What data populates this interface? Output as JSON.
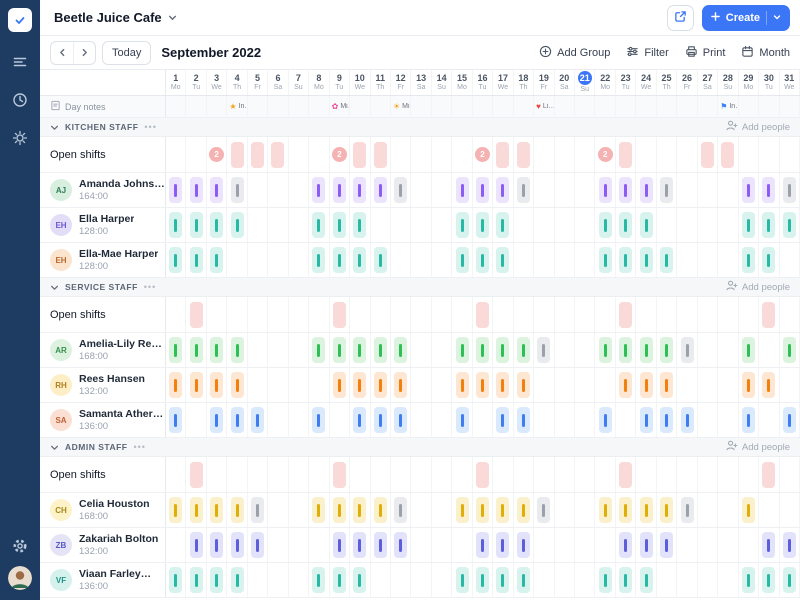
{
  "colors": {
    "accent": "#3b76f6",
    "sidebar": "#1e3c61",
    "open_shift_bg": "#fad9d9",
    "badge_bg": "#f5b2b2",
    "badge_fg": "#ffffff"
  },
  "header": {
    "workspace_name": "Beetle Juice Cafe",
    "create_label": "Create"
  },
  "toolbar": {
    "today": "Today",
    "title": "September 2022",
    "add_group": "Add Group",
    "filter": "Filter",
    "print": "Print",
    "view": "Month"
  },
  "calendar": {
    "today": 21,
    "notes_label": "Day notes",
    "days": [
      {
        "n": 1,
        "d": "Mo"
      },
      {
        "n": 2,
        "d": "Tu"
      },
      {
        "n": 3,
        "d": "We"
      },
      {
        "n": 4,
        "d": "Th"
      },
      {
        "n": 5,
        "d": "Fr"
      },
      {
        "n": 6,
        "d": "Sa"
      },
      {
        "n": 7,
        "d": "Su"
      },
      {
        "n": 8,
        "d": "Mo"
      },
      {
        "n": 9,
        "d": "Tu"
      },
      {
        "n": 10,
        "d": "We"
      },
      {
        "n": 11,
        "d": "Th"
      },
      {
        "n": 12,
        "d": "Fr"
      },
      {
        "n": 13,
        "d": "Sa"
      },
      {
        "n": 14,
        "d": "Su"
      },
      {
        "n": 15,
        "d": "Mo"
      },
      {
        "n": 16,
        "d": "Tu"
      },
      {
        "n": 17,
        "d": "We"
      },
      {
        "n": 18,
        "d": "Th"
      },
      {
        "n": 19,
        "d": "Fr"
      },
      {
        "n": 20,
        "d": "Sa"
      },
      {
        "n": 21,
        "d": "Su"
      },
      {
        "n": 22,
        "d": "Mo"
      },
      {
        "n": 23,
        "d": "Tu"
      },
      {
        "n": 24,
        "d": "We"
      },
      {
        "n": 25,
        "d": "Th"
      },
      {
        "n": 26,
        "d": "Fr"
      },
      {
        "n": 27,
        "d": "Sa"
      },
      {
        "n": 28,
        "d": "Su"
      },
      {
        "n": 29,
        "d": "Mo"
      },
      {
        "n": 30,
        "d": "Tu"
      },
      {
        "n": 31,
        "d": "We"
      }
    ],
    "notes": [
      {
        "day": 4,
        "icon": "★",
        "color": "#f5a623",
        "text": "In…"
      },
      {
        "day": 9,
        "icon": "✿",
        "color": "#ec4899",
        "text": "Mi…"
      },
      {
        "day": 12,
        "icon": "☀",
        "color": "#f59e0b",
        "text": "Mi…"
      },
      {
        "day": 19,
        "icon": "♥",
        "color": "#ef4444",
        "text": "Li…"
      },
      {
        "day": 28,
        "icon": "⚑",
        "color": "#3b82f6",
        "text": "In…"
      }
    ]
  },
  "palette": {
    "purple": {
      "bg": "#ece3fc",
      "bar": "#8b5cf6"
    },
    "teal": {
      "bg": "#d8f3ee",
      "bar": "#27b9a5"
    },
    "green": {
      "bg": "#dcf4df",
      "bar": "#2fbf57"
    },
    "orange": {
      "bg": "#fde7d2",
      "bar": "#f2800d"
    },
    "blue": {
      "bg": "#dbe9fd",
      "bar": "#3f7ef0"
    },
    "yellow": {
      "bg": "#faf0cb",
      "bar": "#dfae09"
    },
    "indigo": {
      "bg": "#e2e3fa",
      "bar": "#5c5fd9"
    },
    "gray": {
      "bg": "#e9ebee",
      "bar": "#9aa1ab"
    }
  },
  "groups": [
    {
      "name": "KITCHEN STAFF",
      "more_label": "•••",
      "add_people_label": "Add people",
      "open_label": "Open shifts",
      "open_badges": [
        {
          "day": 3,
          "count": "2"
        },
        {
          "day": 9,
          "count": "2"
        },
        {
          "day": 16,
          "count": "2"
        },
        {
          "day": 22,
          "count": "2"
        }
      ],
      "open_blocks": [
        4,
        5,
        6,
        10,
        11,
        17,
        18,
        23,
        27,
        28
      ],
      "employees": [
        {
          "name": "Amanda Johnson",
          "hours": "164:00",
          "color": "purple",
          "avatar_bg": "#d8eede",
          "avatar_fg": "#2f7d5a",
          "days": [
            1,
            2,
            3,
            4,
            8,
            9,
            10,
            11,
            12,
            15,
            16,
            17,
            18,
            22,
            23,
            24,
            25,
            29,
            30,
            31
          ],
          "gray_days": [
            4,
            12,
            18,
            25,
            31
          ]
        },
        {
          "name": "Ella Harper",
          "hours": "128:00",
          "color": "teal",
          "avatar_bg": "#e3ddf8",
          "avatar_fg": "#6b5bd2",
          "days": [
            1,
            2,
            3,
            4,
            8,
            9,
            10,
            15,
            16,
            17,
            22,
            23,
            24,
            29,
            30,
            31
          ],
          "gray_days": []
        },
        {
          "name": "Ella-Mae Harper",
          "hours": "128:00",
          "color": "teal",
          "avatar_bg": "#fbe4cd",
          "avatar_fg": "#b96a2e",
          "days": [
            1,
            2,
            3,
            8,
            9,
            10,
            11,
            15,
            16,
            17,
            22,
            23,
            24,
            25,
            29,
            30
          ],
          "gray_days": []
        }
      ]
    },
    {
      "name": "SERVICE STAFF",
      "more_label": "•••",
      "add_people_label": "Add people",
      "open_label": "Open shifts",
      "open_badges": [],
      "open_blocks": [
        2,
        9,
        16,
        23,
        30
      ],
      "employees": [
        {
          "name": "Amelia-Lily Reyes",
          "hours": "168:00",
          "color": "green",
          "avatar_bg": "#dcf2de",
          "avatar_fg": "#3a8f4e",
          "days": [
            1,
            2,
            3,
            4,
            8,
            9,
            10,
            11,
            12,
            15,
            16,
            17,
            18,
            19,
            22,
            23,
            24,
            25,
            26,
            29,
            31
          ],
          "gray_days": [
            19,
            26
          ]
        },
        {
          "name": "Rees Hansen",
          "hours": "132:00",
          "color": "orange",
          "avatar_bg": "#fdeec6",
          "avatar_fg": "#b07f1f",
          "days": [
            1,
            2,
            3,
            4,
            9,
            10,
            11,
            12,
            15,
            16,
            17,
            18,
            23,
            24,
            25,
            29,
            30
          ],
          "gray_days": []
        },
        {
          "name": "Samanta Atherton",
          "hours": "136:00",
          "color": "blue",
          "avatar_bg": "#fbdfd2",
          "avatar_fg": "#c05f35",
          "days": [
            1,
            3,
            4,
            5,
            8,
            10,
            11,
            12,
            15,
            17,
            18,
            22,
            24,
            25,
            26,
            29,
            31
          ],
          "gray_days": []
        }
      ]
    },
    {
      "name": "ADMIN STAFF",
      "more_label": "•••",
      "add_people_label": "Add people",
      "open_label": "Open shifts",
      "open_badges": [],
      "open_blocks": [
        2,
        9,
        16,
        23,
        30
      ],
      "employees": [
        {
          "name": "Celia Houston",
          "hours": "168:00",
          "color": "yellow",
          "avatar_bg": "#fdf2c8",
          "avatar_fg": "#a88a1a",
          "days": [
            1,
            2,
            3,
            4,
            5,
            8,
            9,
            10,
            11,
            12,
            15,
            16,
            17,
            18,
            19,
            22,
            23,
            24,
            25,
            26,
            29
          ],
          "gray_days": [
            5,
            12,
            19,
            26
          ]
        },
        {
          "name": "Zakariah Bolton",
          "hours": "132:00",
          "color": "indigo",
          "avatar_bg": "#e4e4f6",
          "avatar_fg": "#5858c9",
          "days": [
            2,
            3,
            4,
            5,
            9,
            10,
            11,
            12,
            16,
            17,
            18,
            23,
            24,
            25,
            30,
            31
          ],
          "gray_days": []
        },
        {
          "name": "Viaan Farley…",
          "hours": "136:00",
          "color": "teal",
          "avatar_bg": "#d5f1ec",
          "avatar_fg": "#1f9383",
          "days": [
            1,
            2,
            3,
            4,
            8,
            9,
            10,
            15,
            16,
            17,
            18,
            22,
            23,
            24,
            29,
            30,
            31
          ],
          "gray_days": []
        }
      ]
    }
  ]
}
